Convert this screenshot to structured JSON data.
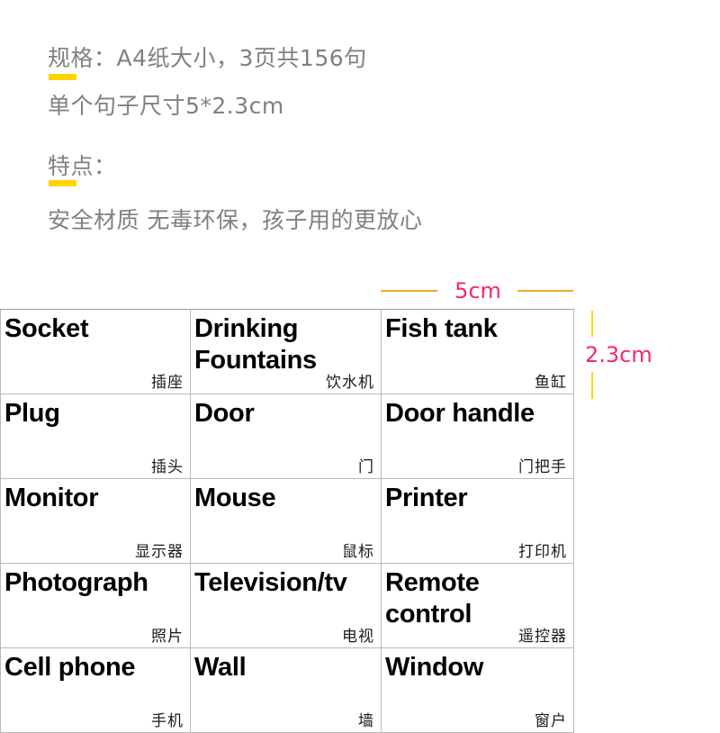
{
  "description": {
    "spec_line_1": "规格：A4纸大小，3页共156句",
    "spec_line_2": "单个句子尺寸5*2.3cm",
    "feature_heading": "特点：",
    "feature_line": "安全材质 无毒环保，孩子用的更放心"
  },
  "dimensions": {
    "width_label": "5cm",
    "height_label": "2.3cm",
    "rule_color": "#F5A623",
    "tick_color": "#FFD400",
    "label_color": "#F5286E"
  },
  "colors": {
    "text_gray": "#808080",
    "highlight_yellow": "#FFD400",
    "pink": "#F5286E",
    "orange": "#F5A623",
    "card_border": "#b9b9b9"
  },
  "cards": {
    "rows": [
      [
        {
          "en": "Socket",
          "zh": "插座"
        },
        {
          "en": "Drinking Fountains",
          "zh": "饮水机"
        },
        {
          "en": "Fish tank",
          "zh": "鱼缸"
        }
      ],
      [
        {
          "en": "Plug",
          "zh": "插头"
        },
        {
          "en": "Door",
          "zh": "门"
        },
        {
          "en": "Door handle",
          "zh": "门把手"
        }
      ],
      [
        {
          "en": "Monitor",
          "zh": "显示器"
        },
        {
          "en": "Mouse",
          "zh": "鼠标"
        },
        {
          "en": "Printer",
          "zh": "打印机"
        }
      ],
      [
        {
          "en": "Photograph",
          "zh": "照片"
        },
        {
          "en": "Television/tv",
          "zh": "电视"
        },
        {
          "en": "Remote control",
          "zh": "遥控器"
        }
      ],
      [
        {
          "en": "Cell phone",
          "zh": "手机"
        },
        {
          "en": "Wall",
          "zh": "墙"
        },
        {
          "en": "Window",
          "zh": "窗户"
        }
      ]
    ]
  }
}
